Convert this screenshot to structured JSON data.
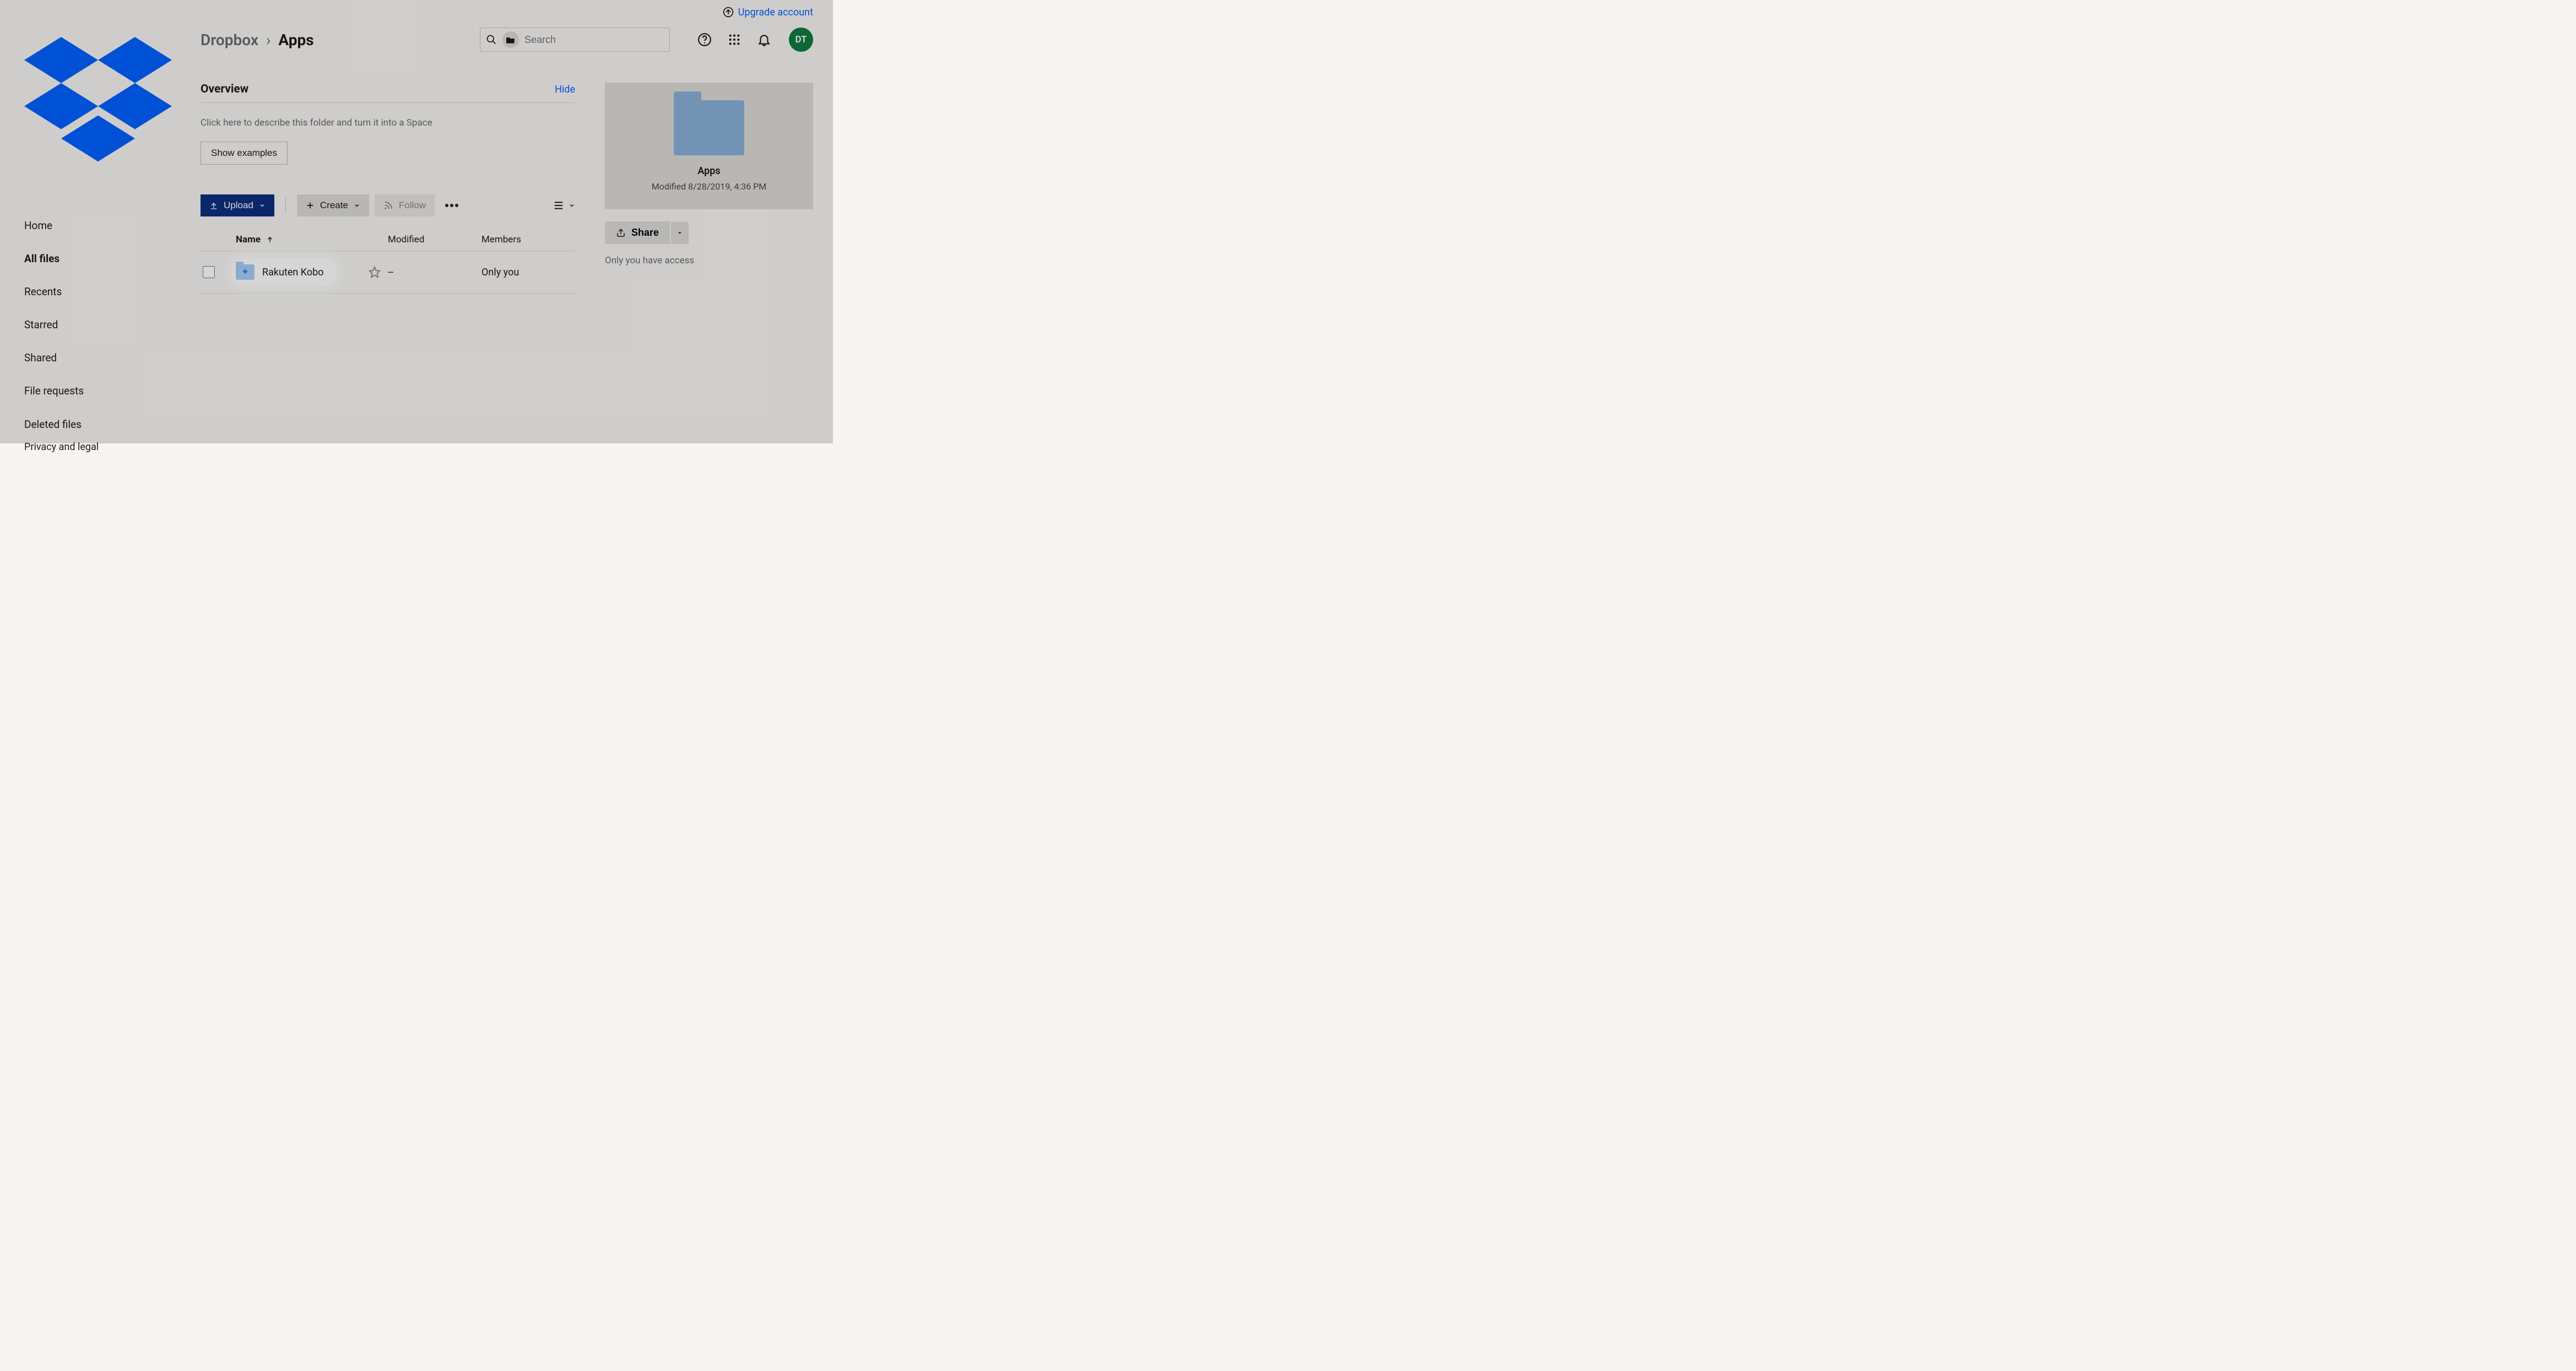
{
  "topbar": {
    "upgrade_label": "Upgrade account"
  },
  "sidebar": {
    "items": [
      {
        "label": "Home"
      },
      {
        "label": "All files"
      },
      {
        "label": "Recents"
      },
      {
        "label": "Starred"
      },
      {
        "label": "Shared"
      },
      {
        "label": "File requests"
      },
      {
        "label": "Deleted files"
      }
    ],
    "footer": "Privacy and legal"
  },
  "breadcrumb": {
    "root": "Dropbox",
    "separator": "›",
    "current": "Apps"
  },
  "search": {
    "placeholder": "Search"
  },
  "avatar": {
    "initials": "DT"
  },
  "overview": {
    "title": "Overview",
    "hide_label": "Hide",
    "description": "Click here to describe this folder and turn it into a Space",
    "show_examples_label": "Show examples"
  },
  "toolbar": {
    "upload_label": "Upload",
    "create_label": "Create",
    "follow_label": "Follow"
  },
  "table": {
    "columns": {
      "name": "Name",
      "modified": "Modified",
      "members": "Members"
    },
    "rows": [
      {
        "name": "Rakuten Kobo",
        "modified": "--",
        "members": "Only you"
      }
    ]
  },
  "preview": {
    "title": "Apps",
    "subtitle": "Modified 8/28/2019, 4:36 PM",
    "share_label": "Share",
    "access_text": "Only you have access"
  }
}
